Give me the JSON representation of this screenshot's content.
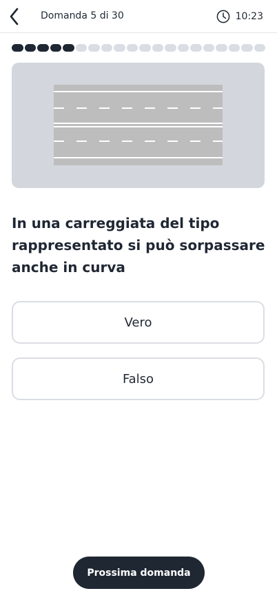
{
  "header": {
    "title": "Domanda 5 di 30",
    "timer": "10:23",
    "back_icon": "chevron-left-icon",
    "timer_icon": "clock-icon"
  },
  "progress": {
    "answered": 5,
    "total": 20
  },
  "question": {
    "image": "road-diagram-two-carriageways",
    "text": "In una carreggiata del tipo rappresentato si può sorpassare anche in curva"
  },
  "answers": [
    {
      "label": "Vero"
    },
    {
      "label": "Falso"
    }
  ],
  "footer": {
    "next_label": "Prossima domanda"
  },
  "colors": {
    "primary": "#1f2733",
    "progress_inactive": "#dadde3",
    "image_background": "#d3d6dd",
    "road": "#bdbdbd"
  }
}
